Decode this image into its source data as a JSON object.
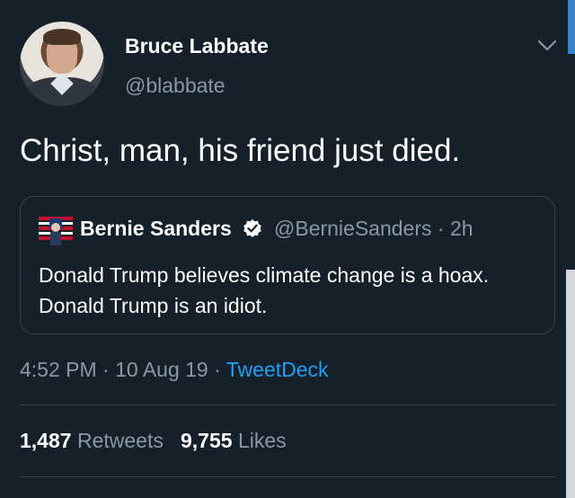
{
  "tweet": {
    "author": {
      "display_name": "Bruce Labbate",
      "handle": "@blabbate",
      "avatar_icon": "person-avatar-icon"
    },
    "text": "Christ, man, his friend just died.",
    "menu_icon": "chevron-down-icon",
    "quoted": {
      "display_name": "Bernie Sanders",
      "handle": "@BernieSanders",
      "time_ago": "2h",
      "separator": "·",
      "verified_icon": "verified-badge-icon",
      "text": "Donald Trump believes climate change is a hoax. Donald Trump is an idiot."
    },
    "meta": {
      "time": "4:52 PM",
      "date": "10 Aug 19",
      "source": "TweetDeck",
      "separator": "·"
    },
    "stats": {
      "retweets_count": "1,487",
      "retweets_label": "Retweets",
      "likes_count": "9,755",
      "likes_label": "Likes"
    }
  },
  "colors": {
    "background": "#15202b",
    "secondary_text": "#8899a6",
    "link": "#1da1f2",
    "border": "#38444d"
  }
}
